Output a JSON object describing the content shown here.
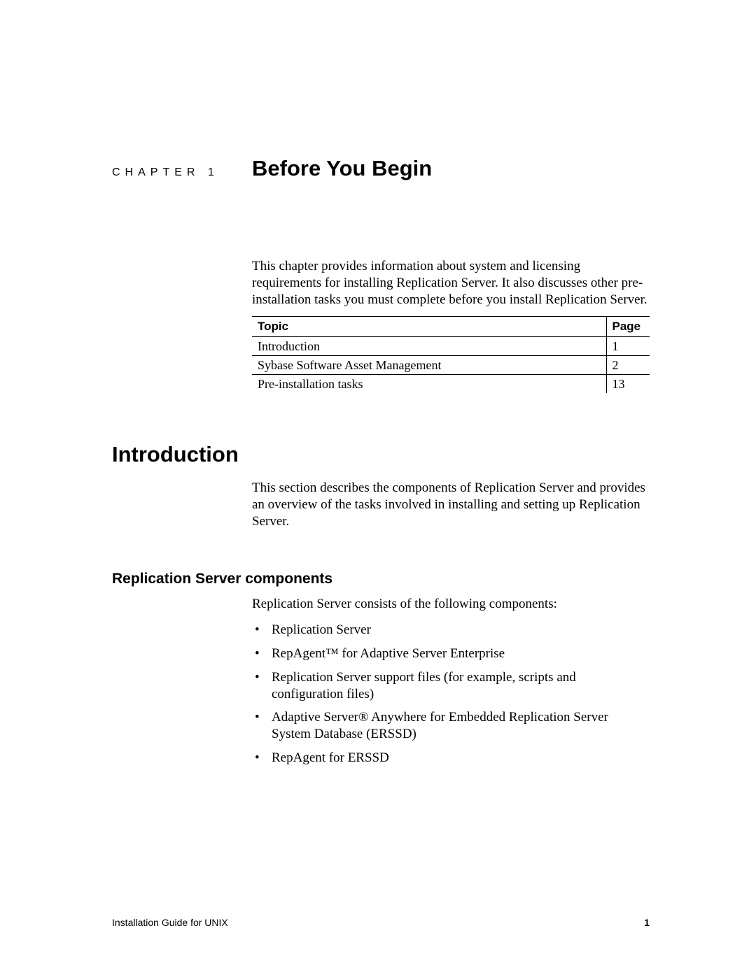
{
  "chapter": {
    "label": "CHAPTER 1",
    "title": "Before You Begin"
  },
  "intro_paragraph": "This chapter provides information about system and licensing requirements for installing Replication Server. It also discusses other pre-installation tasks you must complete before you install Replication Server.",
  "toc": {
    "headers": {
      "topic": "Topic",
      "page": "Page"
    },
    "rows": [
      {
        "topic": "Introduction",
        "page": "1"
      },
      {
        "topic": "Sybase Software Asset Management",
        "page": "2"
      },
      {
        "topic": "Pre-installation tasks",
        "page": "13"
      }
    ]
  },
  "section1": {
    "heading": "Introduction",
    "paragraph": "This section describes the components of Replication Server and provides an overview of the tasks involved in installing and setting up Replication Server."
  },
  "section2": {
    "heading": "Replication Server components",
    "lead": "Replication Server consists of the following components:",
    "bullets": [
      "Replication Server",
      "RepAgent™ for Adaptive Server Enterprise",
      "Replication Server support files (for example, scripts and configuration files)",
      "Adaptive Server® Anywhere for Embedded Replication Server System Database (ERSSD)",
      "RepAgent for ERSSD"
    ]
  },
  "footer": {
    "left": "Installation Guide for UNIX",
    "right": "1"
  }
}
